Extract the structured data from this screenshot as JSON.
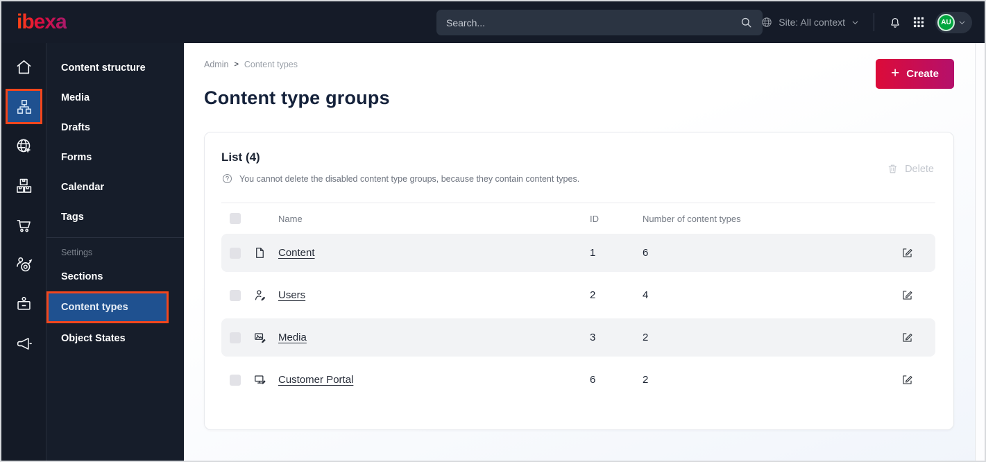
{
  "topbar": {
    "logo_text": "ibexa",
    "search_placeholder": "Search...",
    "site_context_label": "Site: All context",
    "avatar_initials": "AU"
  },
  "icon_rail": {
    "icons": [
      "home",
      "content-structure",
      "site",
      "product-catalog",
      "commerce",
      "personalization",
      "admin",
      "marketing"
    ],
    "active_icon": "content-structure",
    "active_bg": "#1f5190",
    "highlight_border": "#f3461c"
  },
  "sidebar": {
    "items": [
      "Content structure",
      "Media",
      "Drafts",
      "Forms",
      "Calendar",
      "Tags"
    ],
    "section_label": "Settings",
    "section_items": [
      "Sections",
      "Content types",
      "Object States"
    ],
    "active_item": "Content types"
  },
  "breadcrumb": {
    "root": "Admin",
    "separator": ">",
    "current": "Content types"
  },
  "page": {
    "title": "Content type groups",
    "create_label": "Create"
  },
  "list": {
    "title": "List (4)",
    "info_text": "You cannot delete the disabled content type groups, because they contain content types.",
    "delete_label": "Delete",
    "columns": {
      "name": "Name",
      "id": "ID",
      "count": "Number of content types"
    },
    "rows": [
      {
        "icon": "file-icon",
        "name": "Content",
        "id": "1",
        "count": "6"
      },
      {
        "icon": "user-icon",
        "name": "Users",
        "id": "2",
        "count": "4"
      },
      {
        "icon": "image-icon",
        "name": "Media",
        "id": "3",
        "count": "2"
      },
      {
        "icon": "monitor-icon",
        "name": "Customer Portal",
        "id": "6",
        "count": "2"
      }
    ]
  },
  "colors": {
    "topbar_bg": "#151b28",
    "active_blue": "#1f5190",
    "highlight_orange": "#f3461c",
    "create_gradient_start": "#dc0b39",
    "create_gradient_end": "#b5106b",
    "avatar_green": "#00a63e",
    "row_alt_bg": "#f2f3f5"
  }
}
